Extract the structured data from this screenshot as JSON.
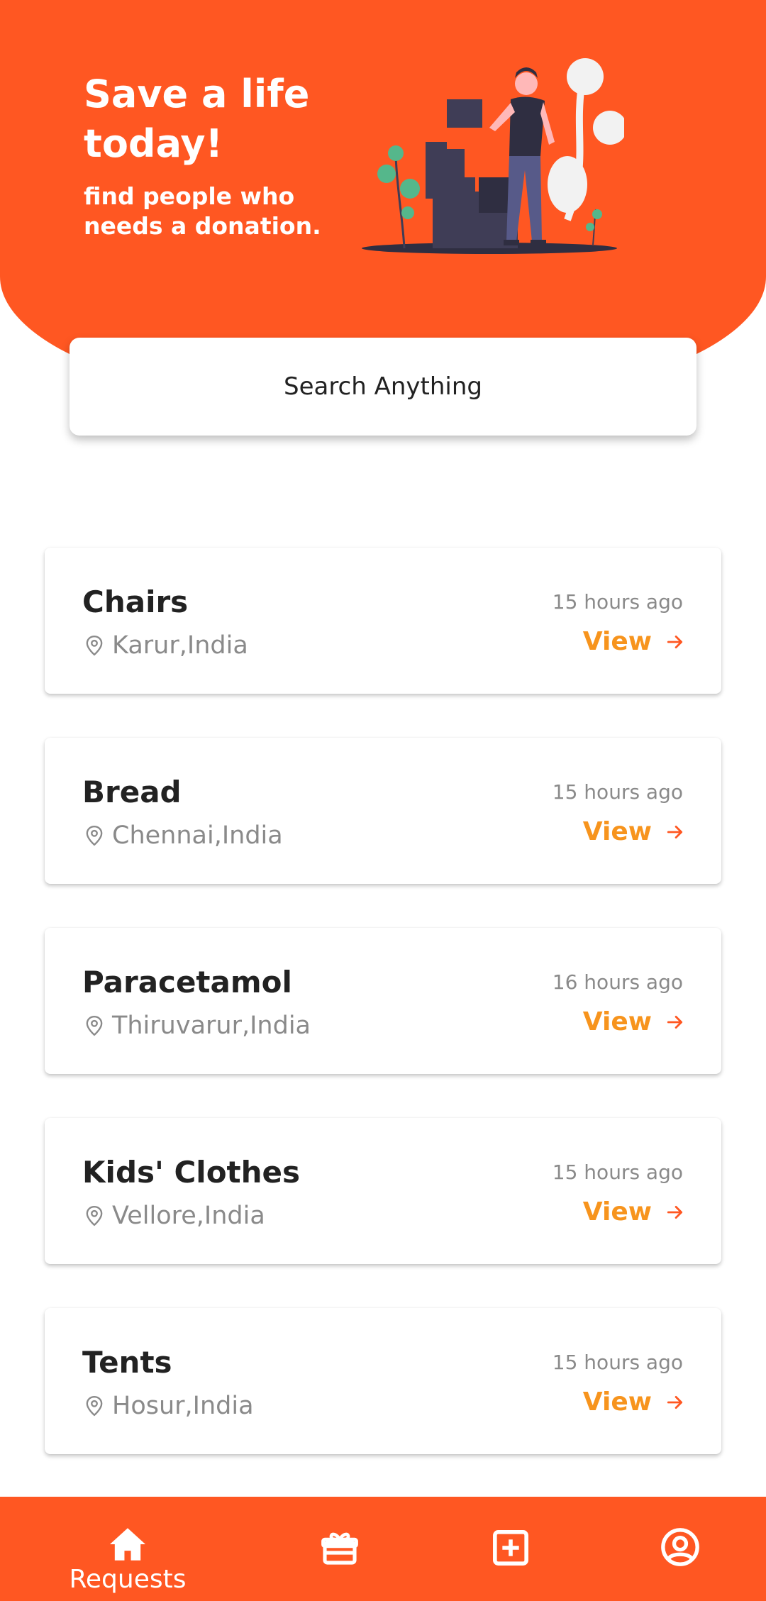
{
  "hero": {
    "title": "Save a life today!",
    "subtitle": "find people who needs a donation."
  },
  "search": {
    "placeholder": "Search Anything"
  },
  "requests": [
    {
      "title": "Chairs",
      "location": "Karur,India",
      "time": "15 hours ago",
      "action": "View"
    },
    {
      "title": "Bread",
      "location": "Chennai,India",
      "time": "15 hours ago",
      "action": "View"
    },
    {
      "title": "Paracetamol",
      "location": "Thiruvarur,India",
      "time": "16 hours ago",
      "action": "View"
    },
    {
      "title": "Kids' Clothes",
      "location": "Vellore,India",
      "time": "15 hours ago",
      "action": "View"
    },
    {
      "title": "Tents",
      "location": "Hosur,India",
      "time": "15 hours ago",
      "action": "View"
    }
  ],
  "nav": {
    "items": [
      {
        "label": "Requests",
        "icon": "home-icon",
        "active": true
      },
      {
        "label": "",
        "icon": "gift-icon",
        "active": false
      },
      {
        "label": "",
        "icon": "plus-square-icon",
        "active": false
      },
      {
        "label": "",
        "icon": "user-circle-icon",
        "active": false
      }
    ]
  },
  "colors": {
    "brand": "#ff5722",
    "accent": "#f7941d",
    "muted": "#8a8a8a"
  }
}
